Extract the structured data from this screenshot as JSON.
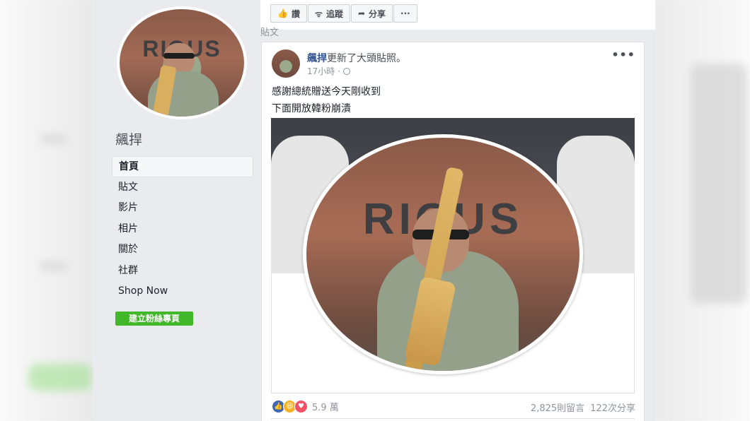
{
  "page": {
    "name": "飆捍"
  },
  "nav": {
    "items": [
      {
        "label": "首頁",
        "active": true
      },
      {
        "label": "貼文"
      },
      {
        "label": "影片"
      },
      {
        "label": "相片"
      },
      {
        "label": "關於"
      },
      {
        "label": "社群"
      },
      {
        "label": "Shop Now"
      }
    ],
    "create_button": "建立粉絲專頁"
  },
  "actions": {
    "like": "讚",
    "follow": "追蹤",
    "share": "分享",
    "more": "···"
  },
  "section": {
    "posts_label": "貼文"
  },
  "post": {
    "author": "飆捍",
    "action_text": "更新了大頭貼照。",
    "time": "17小時",
    "separator": "·",
    "lines": [
      "感謝總統贈送今天剛收到",
      "下面開放韓粉崩潰"
    ],
    "image_text": "RIOUS",
    "reactions_count": "5.9 萬",
    "comments": "2,825則留言",
    "shares": "122次分享"
  },
  "colors": {
    "link": "#365899",
    "button_green": "#42b72a",
    "page_bg": "#e9ebee"
  }
}
